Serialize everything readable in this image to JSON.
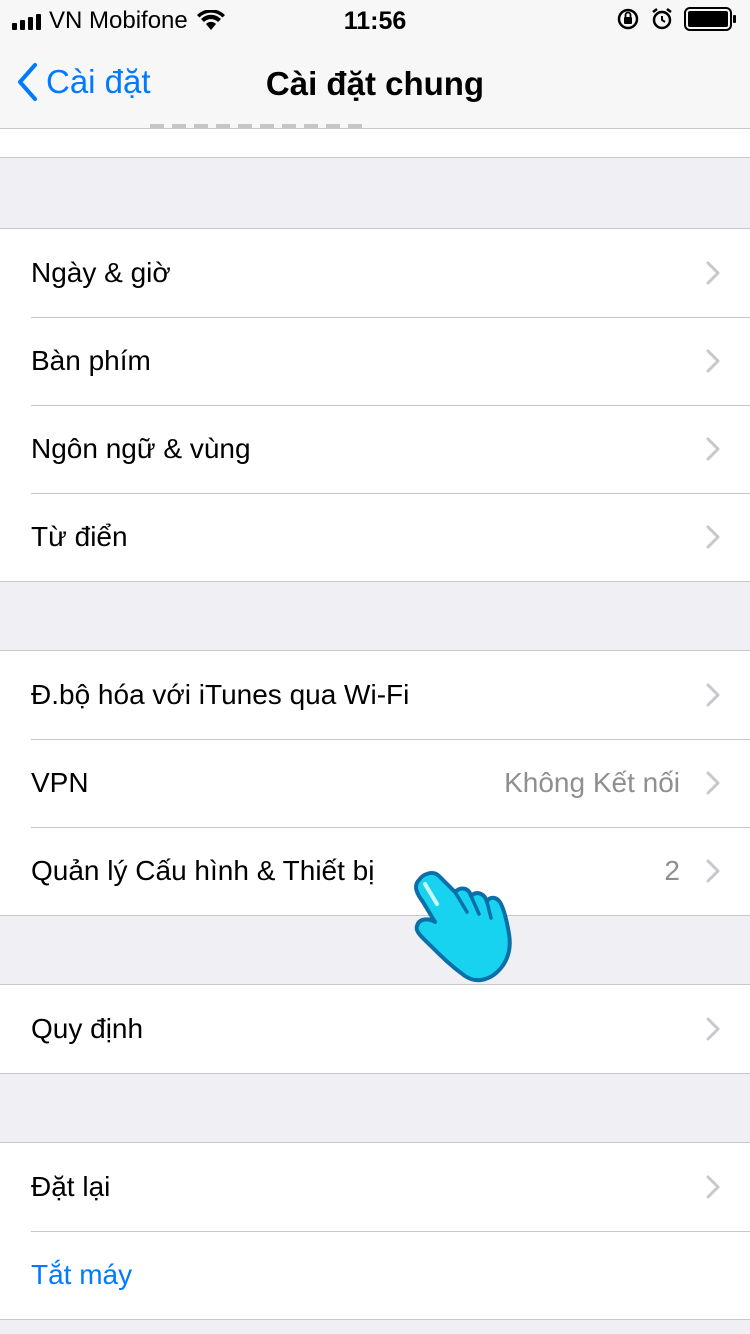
{
  "status_bar": {
    "carrier": "VN Mobifone",
    "time": "11:56",
    "icons": [
      "signal-icon",
      "wifi-icon",
      "orientation-lock-icon",
      "alarm-icon",
      "battery-icon"
    ]
  },
  "nav": {
    "back_label": "Cài đặt",
    "title": "Cài đặt chung"
  },
  "groups": [
    {
      "rows": [
        {
          "label": "Ngày & giờ"
        },
        {
          "label": "Bàn phím"
        },
        {
          "label": "Ngôn ngữ & vùng"
        },
        {
          "label": "Từ điển"
        }
      ]
    },
    {
      "rows": [
        {
          "label": "Đ.bộ hóa với iTunes qua Wi-Fi"
        },
        {
          "label": "VPN",
          "value": "Không Kết nối"
        },
        {
          "label": "Quản lý Cấu hình & Thiết bị",
          "value": "2"
        }
      ]
    },
    {
      "rows": [
        {
          "label": "Quy định"
        }
      ]
    },
    {
      "rows": [
        {
          "label": "Đặt lại"
        },
        {
          "label": "Tắt máy"
        }
      ]
    }
  ],
  "colors": {
    "accent": "#007aff",
    "background": "#efeff4",
    "pointer": "#17d3f0"
  }
}
